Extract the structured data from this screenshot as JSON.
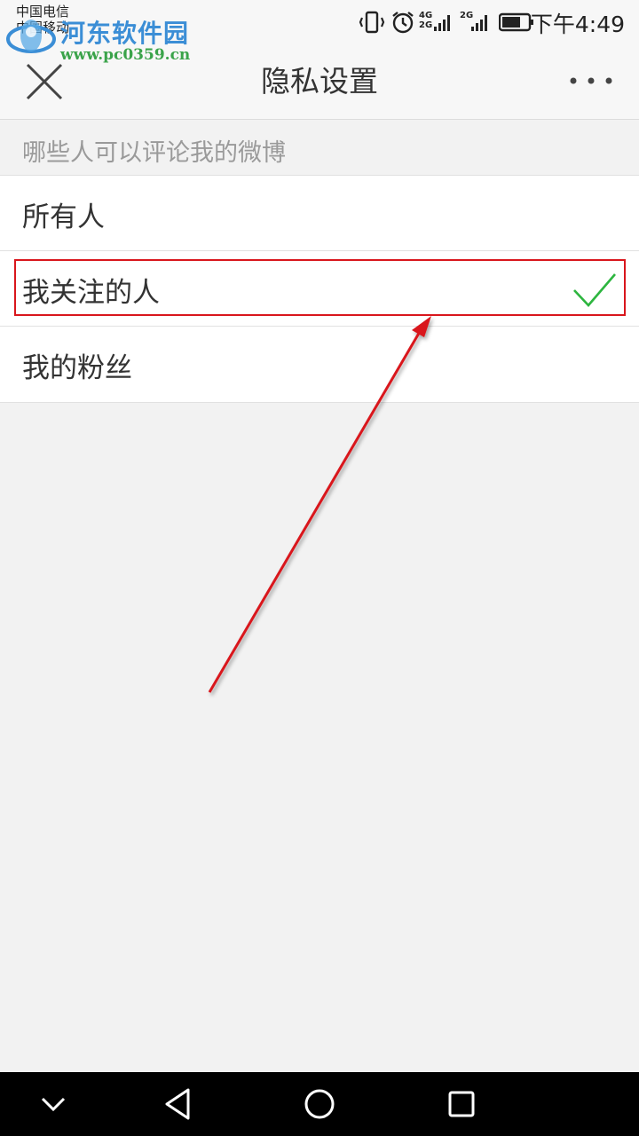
{
  "status_bar": {
    "carrier_1": "中国电信",
    "carrier_2": "中国移动",
    "network_1_top": "4G",
    "network_1_bottom": "2G",
    "network_2": "2G",
    "time": "下午4:49",
    "icons": [
      "vibrate-icon",
      "alarm-icon",
      "signal-icon",
      "signal-icon",
      "battery-icon"
    ]
  },
  "watermark": {
    "title": "河东软件园",
    "url": "www.pc0359.cn"
  },
  "header": {
    "title": "隐私设置",
    "close_icon": "close-icon",
    "more_icon": "more-dots-icon"
  },
  "section": {
    "header": "哪些人可以评论我的微博",
    "options": [
      {
        "label": "所有人",
        "selected": false
      },
      {
        "label": "我关注的人",
        "selected": true
      },
      {
        "label": "我的粉丝",
        "selected": false
      }
    ]
  },
  "navbar": {
    "icons": [
      "chevron-down-icon",
      "back-triangle-icon",
      "home-circle-icon",
      "recents-square-icon"
    ]
  },
  "colors": {
    "check": "#2db53f",
    "annotation": "#d9161c",
    "background": "#f2f2f2"
  }
}
